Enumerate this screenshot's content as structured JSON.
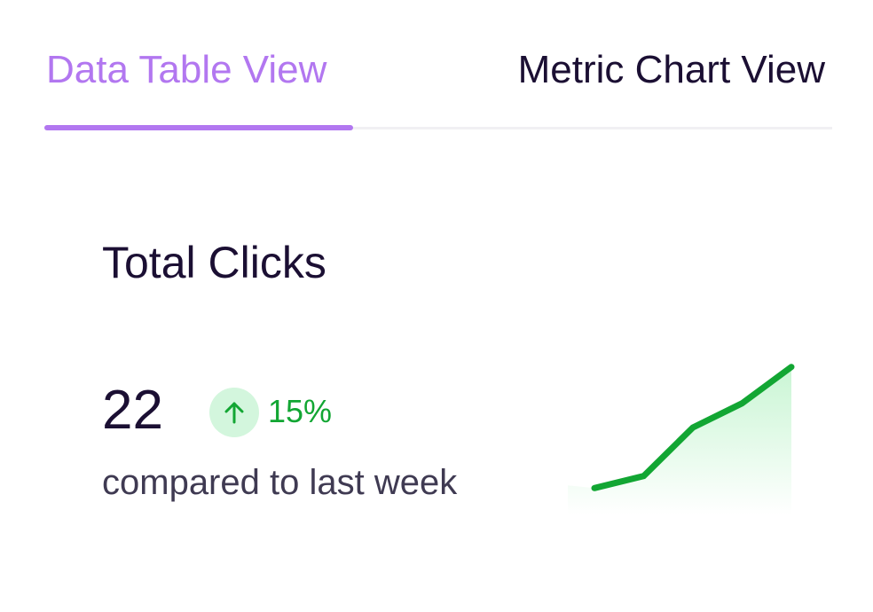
{
  "tabs": [
    {
      "label": "Data Table View",
      "active": true
    },
    {
      "label": "Metric Chart View",
      "active": false
    }
  ],
  "metric": {
    "title": "Total Clicks",
    "value": "22",
    "change": "15%",
    "change_direction": "up",
    "comparison": "compared to last week"
  },
  "colors": {
    "accent": "#b277f0",
    "positive": "#12a633",
    "positive_bg": "#d3f6dd",
    "text_primary": "#1b0f33",
    "text_secondary": "#3f3a52"
  },
  "icons": {
    "trend": "arrow-up-icon"
  },
  "chart_data": {
    "type": "area",
    "series": [
      {
        "values": [
          1,
          2,
          6,
          8,
          11
        ]
      }
    ],
    "ylim": [
      0,
      12
    ],
    "grid": false
  }
}
